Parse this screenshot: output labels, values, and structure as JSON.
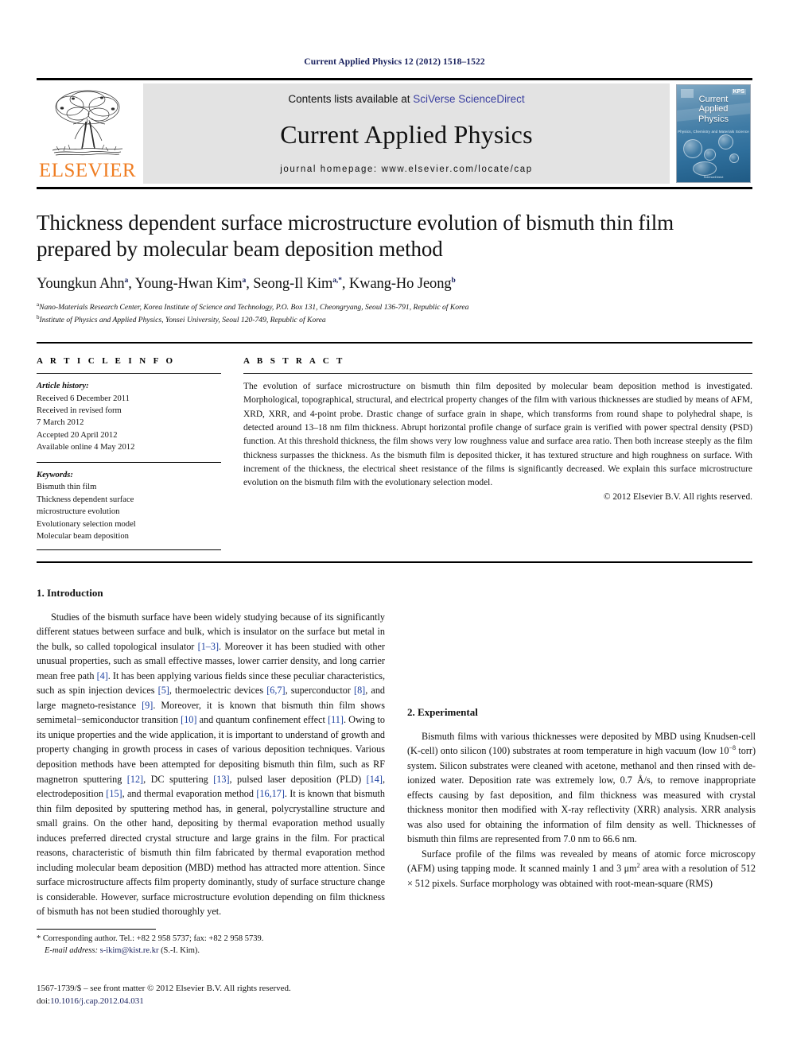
{
  "running_head": "Current Applied Physics 12 (2012) 1518–1522",
  "masthead": {
    "publisher_word": "ELSEVIER",
    "contents_prefix": "Contents lists available at ",
    "contents_link": "SciVerse ScienceDirect",
    "journal_title": "Current Applied Physics",
    "homepage": "journal homepage: www.elsevier.com/locate/cap",
    "cover": {
      "title_line1": "Current",
      "title_line2": "Applied",
      "title_line3": "Physics",
      "subtitle": "Physics, Chemistry and Materials Science",
      "kps_badge": "KPS",
      "footer": "ScienceDirect"
    },
    "link_color": "#3a3fa0",
    "brand_color": "#ef7d22"
  },
  "article": {
    "title": "Thickness dependent surface microstructure evolution of bismuth thin film prepared by molecular beam deposition method",
    "authors": [
      {
        "name": "Youngkun Ahn",
        "sup": "a"
      },
      {
        "name": "Young-Hwan Kim",
        "sup": "a"
      },
      {
        "name": "Seong-Il Kim",
        "sup": "a,*"
      },
      {
        "name": "Kwang-Ho Jeong",
        "sup": "b"
      }
    ],
    "affiliations": [
      {
        "marker": "a",
        "text": "Nano-Materials Research Center, Korea Institute of Science and Technology, P.O. Box 131, Cheongryang, Seoul 136-791, Republic of Korea"
      },
      {
        "marker": "b",
        "text": "Institute of Physics and Applied Physics, Yonsei University, Seoul 120-749, Republic of Korea"
      }
    ]
  },
  "article_info": {
    "heading": "A R T I C L E   I N F O",
    "history_label": "Article history:",
    "history": [
      "Received 6 December 2011",
      "Received in revised form",
      "7 March 2012",
      "Accepted 20 April 2012",
      "Available online 4 May 2012"
    ],
    "keywords_label": "Keywords:",
    "keywords": [
      "Bismuth thin film",
      "Thickness dependent surface",
      "microstructure evolution",
      "Evolutionary selection model",
      "Molecular beam deposition"
    ]
  },
  "abstract": {
    "heading": "A B S T R A C T",
    "text": "The evolution of surface microstructure on bismuth thin film deposited by molecular beam deposition method is investigated. Morphological, topographical, structural, and electrical property changes of the film with various thicknesses are studied by means of AFM, XRD, XRR, and 4-point probe. Drastic change of surface grain in shape, which transforms from round shape to polyhedral shape, is detected around 13–18 nm film thickness. Abrupt horizontal profile change of surface grain is verified with power spectral density (PSD) function. At this threshold thickness, the film shows very low roughness value and surface area ratio. Then both increase steeply as the film thickness surpasses the thickness. As the bismuth film is deposited thicker, it has textured structure and high roughness on surface. With increment of the thickness, the electrical sheet resistance of the films is significantly decreased. We explain this surface microstructure evolution on the bismuth film with the evolutionary selection model.",
    "copyright": "© 2012 Elsevier B.V. All rights reserved."
  },
  "sections": {
    "introduction_heading": "1. Introduction",
    "experimental_heading": "2. Experimental"
  },
  "body": {
    "intro_p1_a": "Studies of the bismuth surface have been widely studying because of its significantly different statues between surface and bulk, which is insulator on the surface but metal in the bulk, so called topological insulator ",
    "intro_ref_1_3": "[1–3]",
    "intro_p1_b": ". Moreover it has been studied with other unusual properties, such as small effective masses, lower carrier density, and long carrier mean free path ",
    "intro_ref_4": "[4]",
    "intro_p1_c": ". It has been applying various fields since these peculiar characteristics, such as spin injection devices ",
    "intro_ref_5": "[5]",
    "intro_p1_d": ", thermoelectric devices ",
    "intro_ref_67": "[6,7]",
    "intro_p1_e": ", superconductor ",
    "intro_ref_8": "[8]",
    "intro_p1_f": ", and large magneto-resistance ",
    "intro_ref_9": "[9]",
    "intro_p1_g": ". Moreover, it is known that bismuth thin film shows semimetal−semiconductor transition ",
    "intro_ref_10": "[10]",
    "intro_p1_h": " and quantum confinement effect ",
    "intro_ref_11": "[11]",
    "intro_p1_i": ". Owing to its unique properties and the wide application, it is important to understand of growth and property changing in growth process in cases of various deposition techniques. Various deposition methods have been attempted for depositing bismuth thin film, such as RF magnetron sputtering ",
    "intro_ref_12": "[12]",
    "intro_p1_j": ", DC sputtering ",
    "intro_ref_13": "[13]",
    "intro_p1_k": ", pulsed laser deposition (PLD) ",
    "intro_ref_14": "[14]",
    "intro_p1_l": ", electrodeposition ",
    "intro_ref_15": "[15]",
    "intro_p1_m": ", and thermal evaporation method ",
    "intro_ref_1617": "[16,17]",
    "intro_p1_n": ". It is known that bismuth thin film deposited by sputtering method has, in general, polycrystalline structure and small grains. On the other hand, depositing by thermal evaporation method usually induces preferred directed crystal structure and large grains in the film. For practical reasons, characteristic of bismuth thin film fabricated by thermal evaporation method including molecular beam deposition (MBD) method has attracted more attention. Since surface microstructure affects film property dominantly, study of surface structure change is considerable. However, surface microstructure evolution depending on film thickness of bismuth has not been studied thoroughly yet.",
    "exp_p1_a": "Bismuth films with various thicknesses were deposited by MBD using Knudsen-cell (K-cell) onto silicon (100) substrates at room temperature in high vacuum (low 10",
    "exp_sup_1": "−8",
    "exp_p1_b": " torr) system. Silicon substrates were cleaned with acetone, methanol and then rinsed with de-ionized water. Deposition rate was extremely low, 0.7 Å/s, to remove inappropriate effects causing by fast deposition, and film thickness was measured with crystal thickness monitor then modified with X-ray reflectivity (XRR) analysis. XRR analysis was also used for obtaining the information of film density as well. Thicknesses of bismuth thin films are represented from 7.0 nm to 66.6 nm.",
    "exp_p2_a": "Surface profile of the films was revealed by means of atomic force microscopy (AFM) using tapping mode. It scanned mainly 1 and 3 μm",
    "exp_sup_2": "2",
    "exp_p2_b": " area with a resolution of 512 × 512 pixels. Surface morphology was obtained with root-mean-square (RMS)"
  },
  "footnote": {
    "corresponding": "* Corresponding author. Tel.: +82 2 958 5737; fax: +82 2 958 5739.",
    "email_label": "E-mail address:",
    "email": "s-ikim@kist.re.kr",
    "email_suffix": "(S.-I. Kim).",
    "issn_line": "1567-1739/$ – see front matter © 2012 Elsevier B.V. All rights reserved.",
    "doi_prefix": "doi:",
    "doi": "10.1016/j.cap.2012.04.031"
  }
}
